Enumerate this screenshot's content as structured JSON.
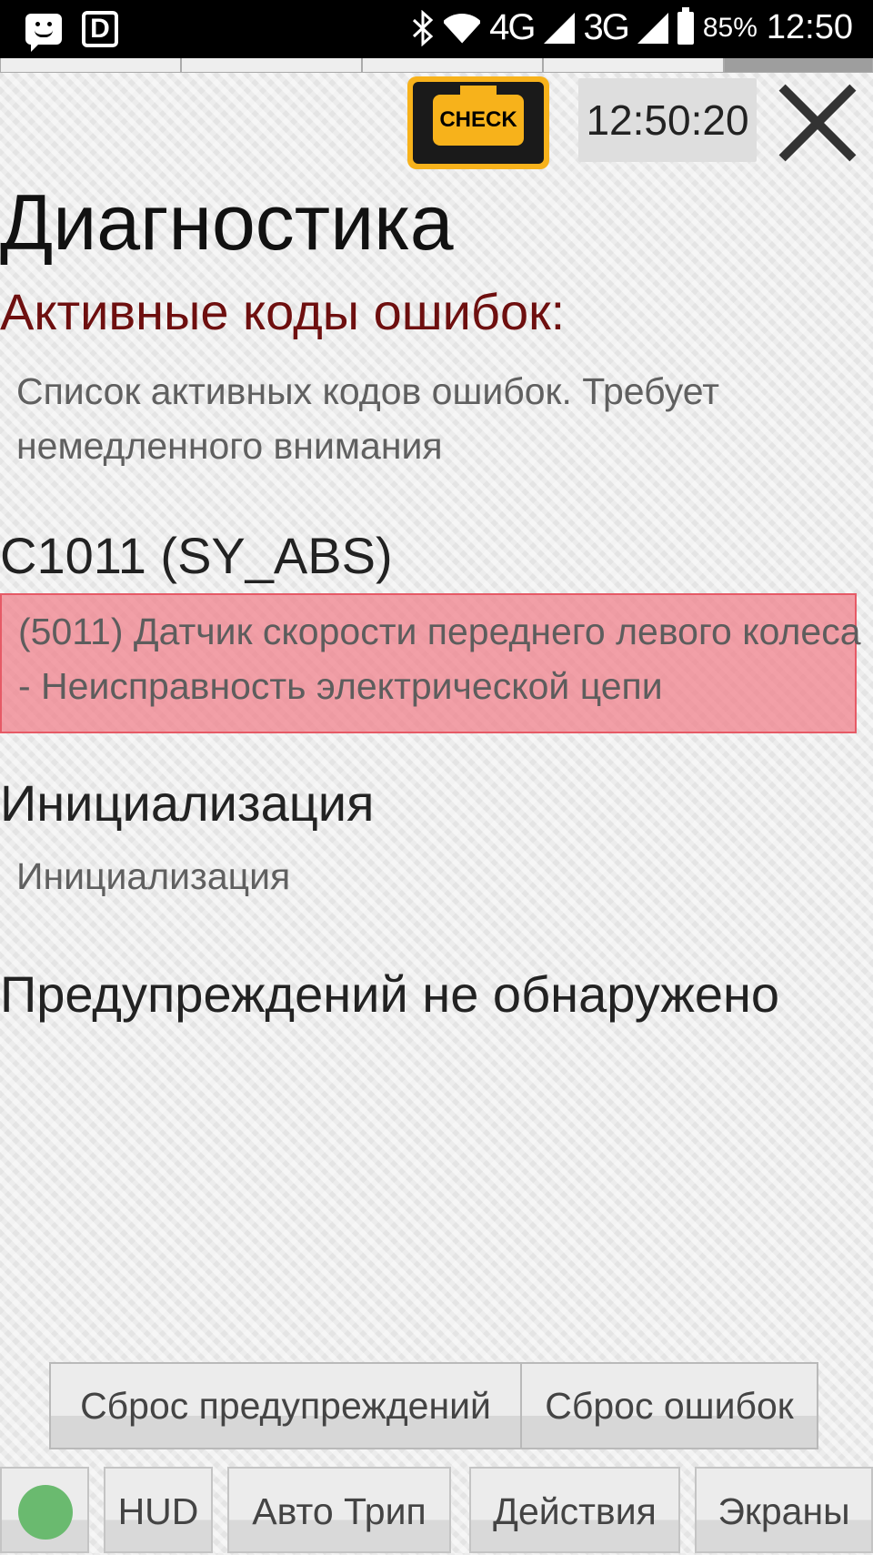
{
  "status_bar": {
    "network_4g": "4G",
    "network_3g": "3G",
    "battery": "85%",
    "time": "12:50"
  },
  "header": {
    "check_label": "CHECK",
    "clock": "12:50:20"
  },
  "main": {
    "title": "Диагностика",
    "active_section_title": "Активные коды ошибок:",
    "active_section_description": "Список активных кодов ошибок. Требует немедленного внимания",
    "error_code": "C1011 (SY_ABS)",
    "error_description": "(5011) Датчик скорости переднего левого колеса - Неисправность электрической цепи",
    "init_title": "Инициализация",
    "init_subtitle": "Инициализация",
    "warnings_title": "Предупреждений не обнаружено"
  },
  "actions": {
    "reset_warnings": "Сброс предупреждений",
    "reset_errors": "Сброс ошибок"
  },
  "bottom_nav": {
    "hud": "HUD",
    "auto_trip": "Авто Трип",
    "actions": "Действия",
    "screens": "Экраны"
  },
  "colors": {
    "check_badge": "#f7b21b",
    "error_highlight": "#f0828c",
    "section_title": "#6e0f0f",
    "status_dot": "#6aba6f"
  },
  "icons": {
    "status_bar_left": [
      "message-icon",
      "d-app-icon"
    ],
    "status_bar_right": [
      "bluetooth-icon",
      "wifi-icon",
      "signal-icon",
      "battery-icon"
    ],
    "check_engine": "check-engine-icon",
    "close": "close-icon"
  }
}
